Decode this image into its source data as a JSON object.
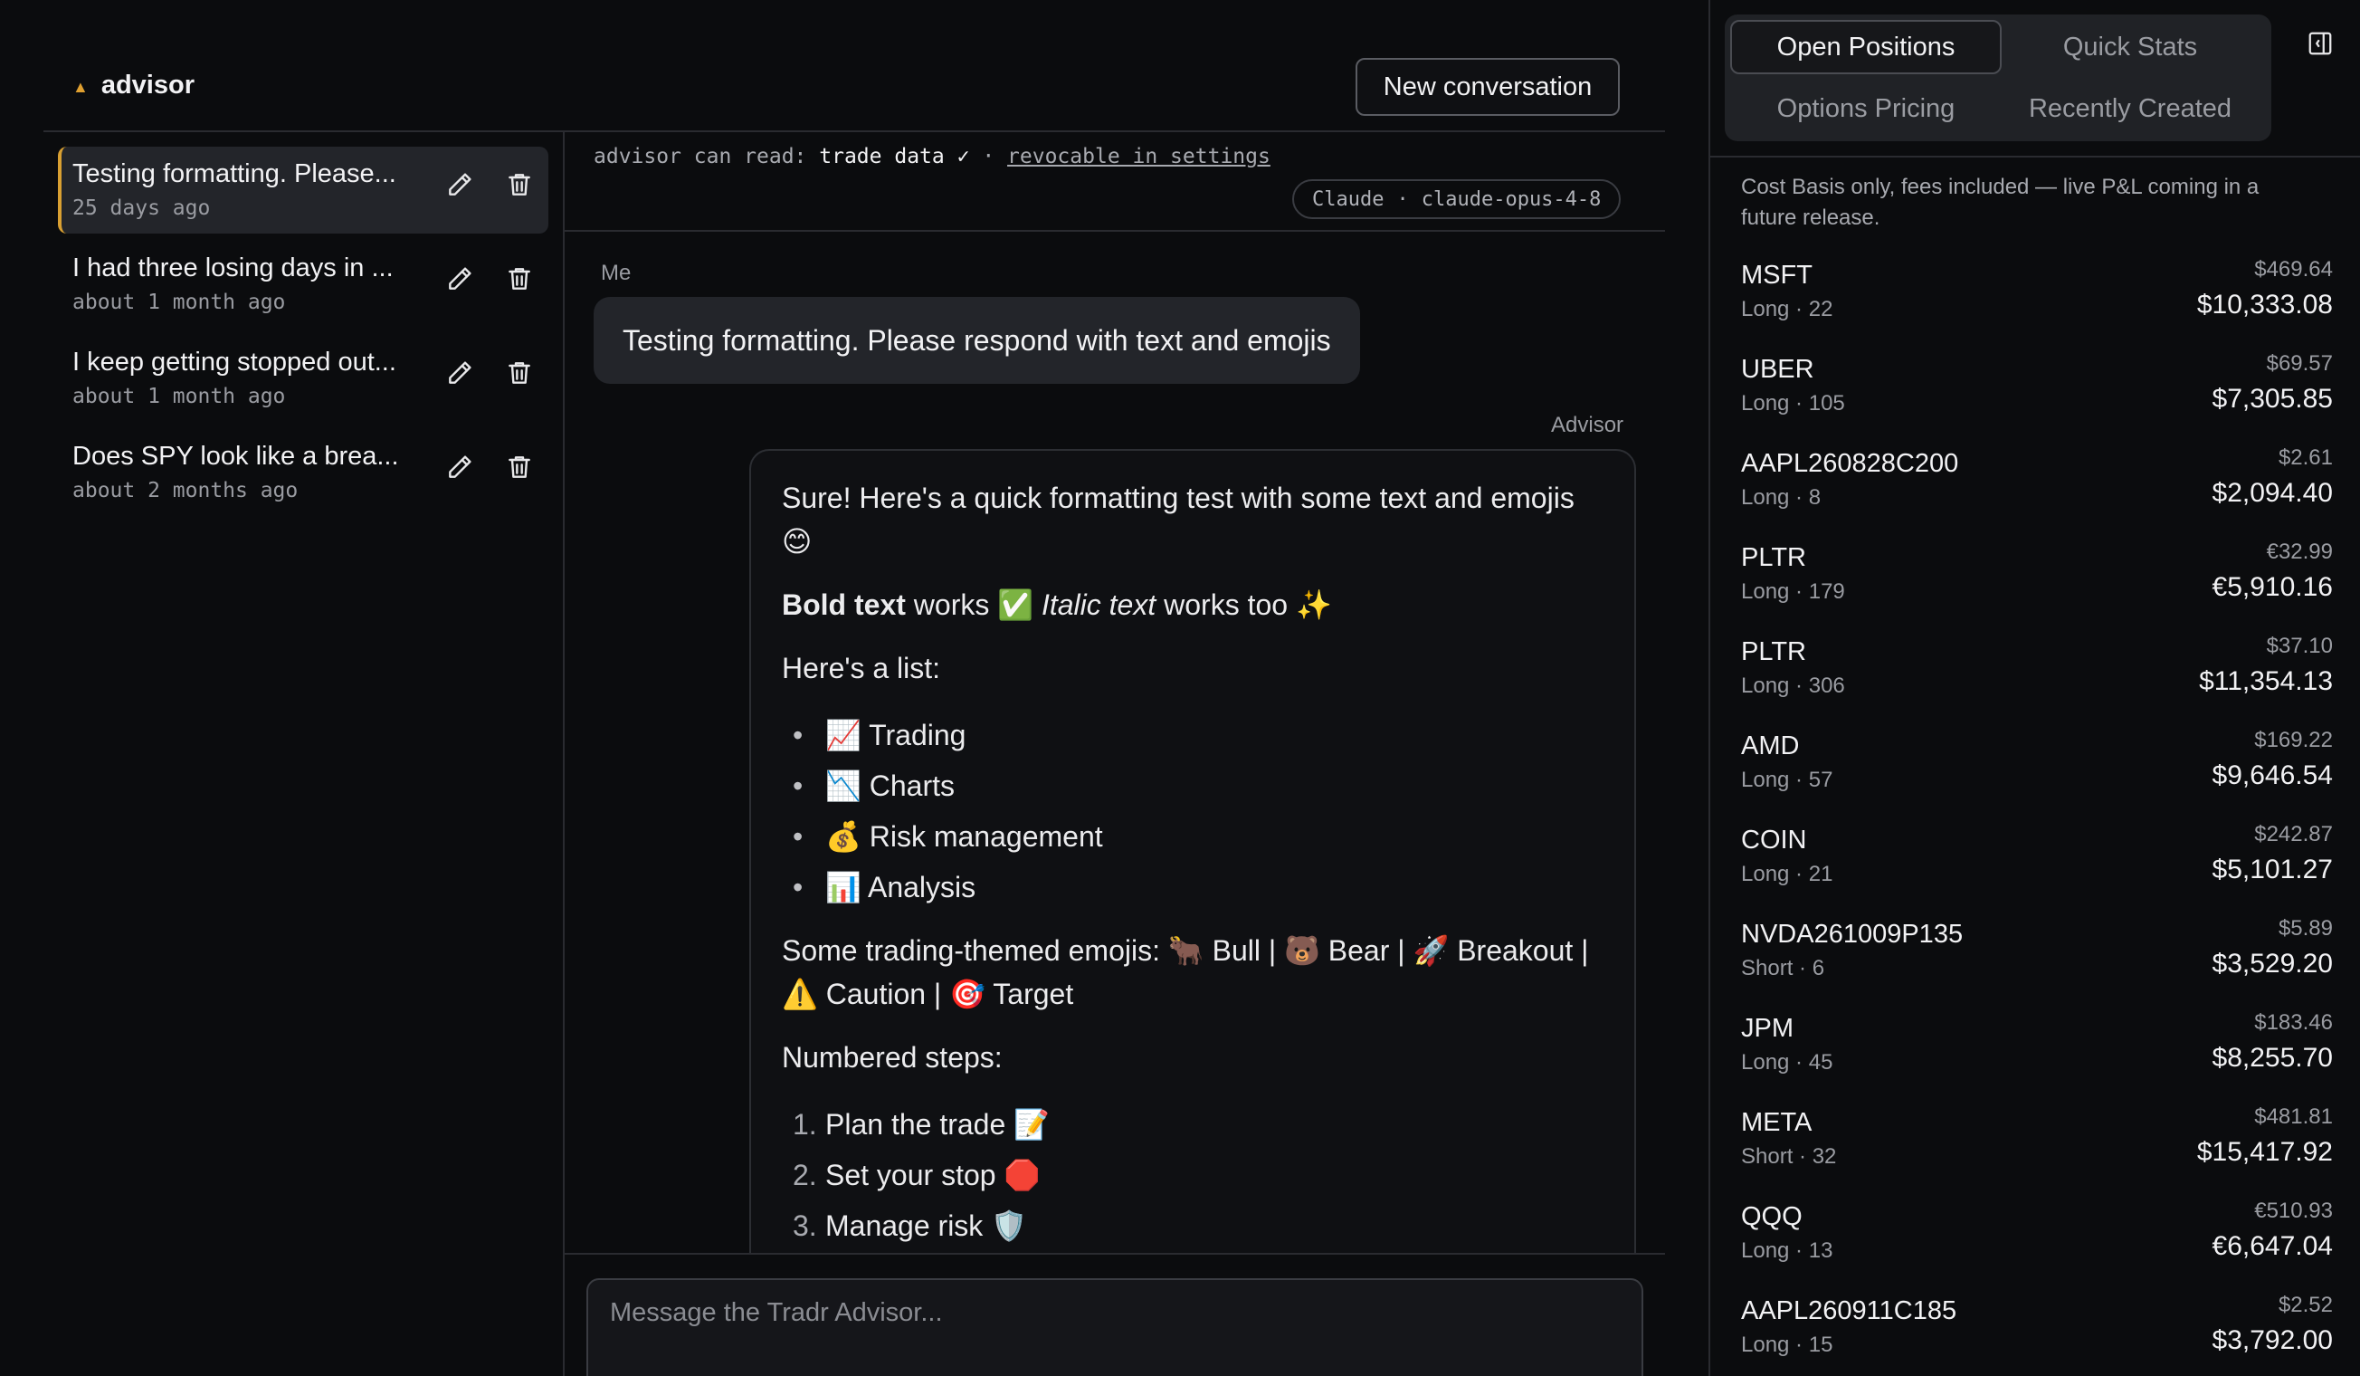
{
  "app": {
    "name": "advisor",
    "new_conversation_label": "New conversation"
  },
  "conversations": [
    {
      "title": "Testing formatting. Please...",
      "time": "25 days ago",
      "active": true
    },
    {
      "title": "I had three losing days in ...",
      "time": "about 1 month ago"
    },
    {
      "title": "I keep getting stopped out...",
      "time": "about 1 month ago"
    },
    {
      "title": "Does SPY look like a brea...",
      "time": "about 2 months ago"
    }
  ],
  "permission": {
    "prefix": "advisor can read:",
    "scope": "trade data",
    "check": "✓",
    "sep": "·",
    "link": "revocable in settings"
  },
  "model": {
    "provider": "Claude",
    "sep": "·",
    "name": "claude-opus-4-8"
  },
  "chat": {
    "me_label": "Me",
    "me_message": "Testing formatting. Please respond with text and emojis",
    "advisor_label": "Advisor",
    "intro": "Sure! Here's a quick formatting test with some text and emojis 😊",
    "bold_text": "Bold text",
    "works1": " works ✅ ",
    "italic_text": "Italic text",
    "works2": " works too ✨",
    "list_heading": "Here's a list:",
    "bullets": [
      "📈 Trading",
      "📉 Charts",
      "💰 Risk management",
      "📊 Analysis"
    ],
    "themed": "Some trading-themed emojis: 🐂 Bull | 🐻 Bear | 🚀 Breakout | ⚠️ Caution | 🎯 Target",
    "steps_heading": "Numbered steps:",
    "steps": [
      {
        "num": "1.",
        "text": "Plan the trade 📝"
      },
      {
        "num": "2.",
        "text": "Set your stop 🛑"
      },
      {
        "num": "3.",
        "text": "Manage risk 🛡️"
      }
    ],
    "input_placeholder": "Message the Tradr Advisor..."
  },
  "right_panel": {
    "tabs": [
      "Open Positions",
      "Quick Stats",
      "Options Pricing",
      "Recently Created"
    ],
    "active_tab": "Open Positions",
    "note": "Cost Basis only, fees included — live P&L coming in a future release.",
    "positions": [
      {
        "symbol": "MSFT",
        "side": "Long · 22",
        "price": "$469.64",
        "basis": "$10,333.08"
      },
      {
        "symbol": "UBER",
        "side": "Long · 105",
        "price": "$69.57",
        "basis": "$7,305.85"
      },
      {
        "symbol": "AAPL260828C200",
        "side": "Long · 8",
        "price": "$2.61",
        "basis": "$2,094.40"
      },
      {
        "symbol": "PLTR",
        "side": "Long · 179",
        "price": "€32.99",
        "basis": "€5,910.16"
      },
      {
        "symbol": "PLTR",
        "side": "Long · 306",
        "price": "$37.10",
        "basis": "$11,354.13"
      },
      {
        "symbol": "AMD",
        "side": "Long · 57",
        "price": "$169.22",
        "basis": "$9,646.54"
      },
      {
        "symbol": "COIN",
        "side": "Long · 21",
        "price": "$242.87",
        "basis": "$5,101.27"
      },
      {
        "symbol": "NVDA261009P135",
        "side": "Short · 6",
        "price": "$5.89",
        "basis": "$3,529.20"
      },
      {
        "symbol": "JPM",
        "side": "Long · 45",
        "price": "$183.46",
        "basis": "$8,255.70"
      },
      {
        "symbol": "META",
        "side": "Short · 32",
        "price": "$481.81",
        "basis": "$15,417.92"
      },
      {
        "symbol": "QQQ",
        "side": "Long · 13",
        "price": "€510.93",
        "basis": "€6,647.04"
      },
      {
        "symbol": "AAPL260911C185",
        "side": "Long · 15",
        "price": "$2.52",
        "basis": "$3,792.00"
      }
    ]
  },
  "colors": {
    "accent": "#d9a032",
    "background": "#0b0c0e",
    "panel": "#23252a"
  }
}
